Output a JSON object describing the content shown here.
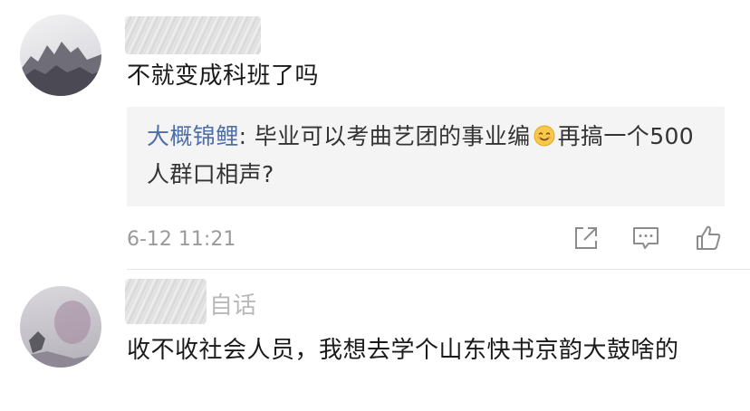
{
  "comments": [
    {
      "username_suffix": "",
      "text": "不就变成科班了吗",
      "reply": {
        "user": "大概锦鲤",
        "separator": ":",
        "text_before_emoji": " 毕业可以考曲艺团的事业编",
        "emoji_name": "smile-emoji",
        "text_after_emoji": "再搞一个500人群口相声?"
      },
      "timestamp": "6-12 11:21",
      "actions": {
        "share_icon": "share-icon",
        "reply_icon": "comment-icon",
        "like_icon": "thumbs-up-icon"
      }
    },
    {
      "username_suffix": "自话",
      "text": "收不收社会人员，我想去学个山东快书京韵大鼓啥的"
    }
  ],
  "colors": {
    "reply_user": "#4e6ea8",
    "reply_background": "#f4f4f4",
    "meta_text": "#9a9a9a",
    "body_text": "#1a1a1a"
  }
}
